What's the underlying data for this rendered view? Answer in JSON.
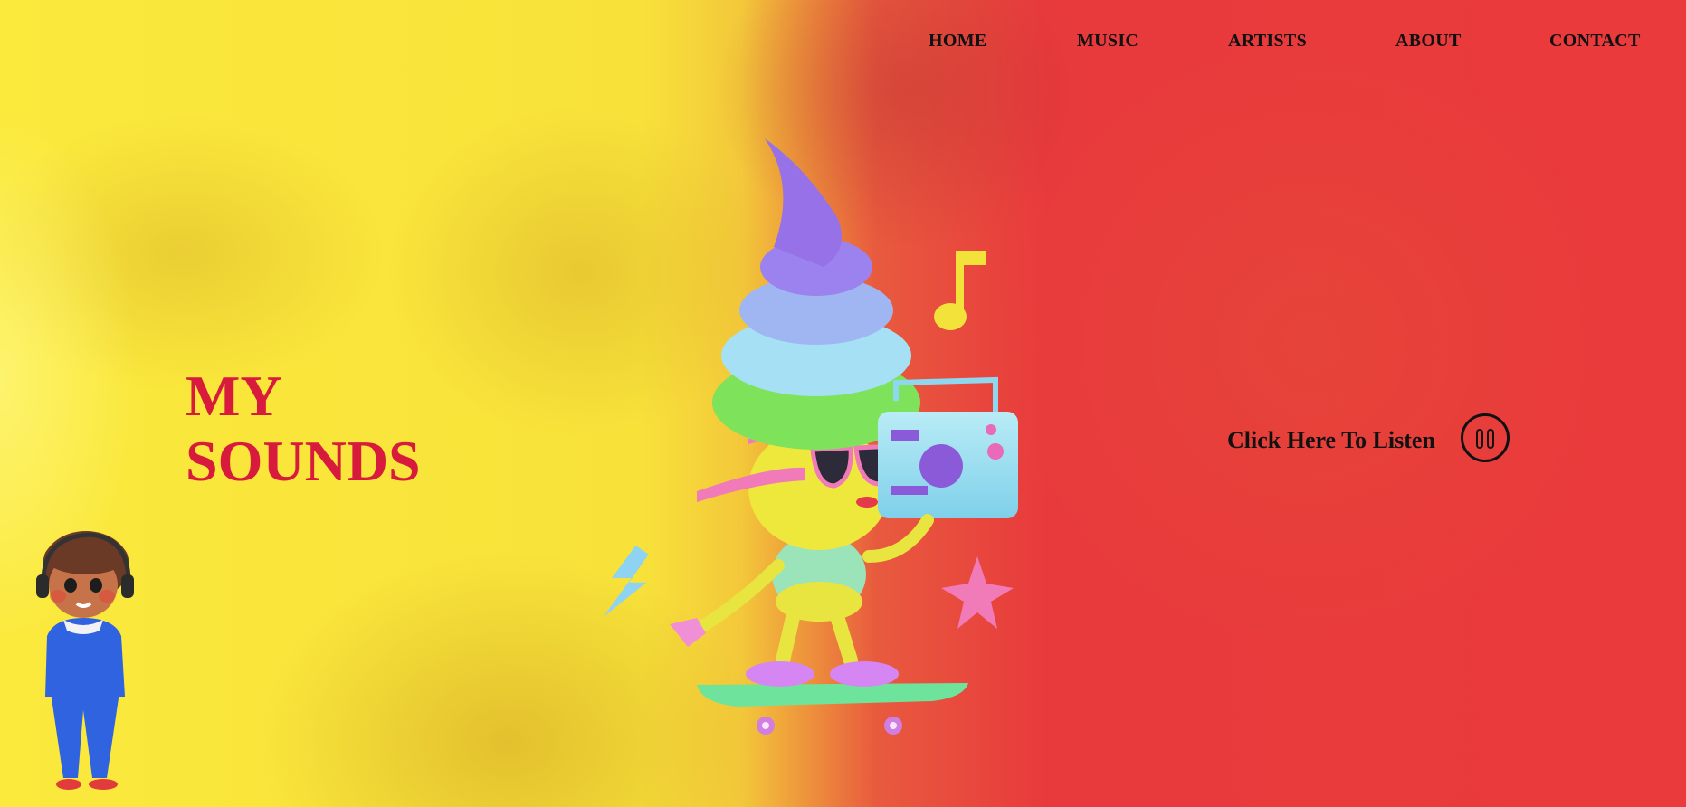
{
  "nav": {
    "items": [
      {
        "label": "HOME"
      },
      {
        "label": "MUSIC"
      },
      {
        "label": "ARTISTS"
      },
      {
        "label": "ABOUT"
      },
      {
        "label": "CONTACT"
      }
    ]
  },
  "hero": {
    "title_line1": "MY",
    "title_line2": "SOUNDS",
    "title_color": "#d81b3c"
  },
  "player": {
    "listen_label": "Click Here To Listen",
    "button_icon": "pause-icon"
  },
  "colors": {
    "background_left": "#fbe93c",
    "background_right": "#e83a3c"
  },
  "illustrations": {
    "mascot": "ice-cream-skater-boombox-illustration",
    "character": "boy-with-headphones-illustration"
  }
}
